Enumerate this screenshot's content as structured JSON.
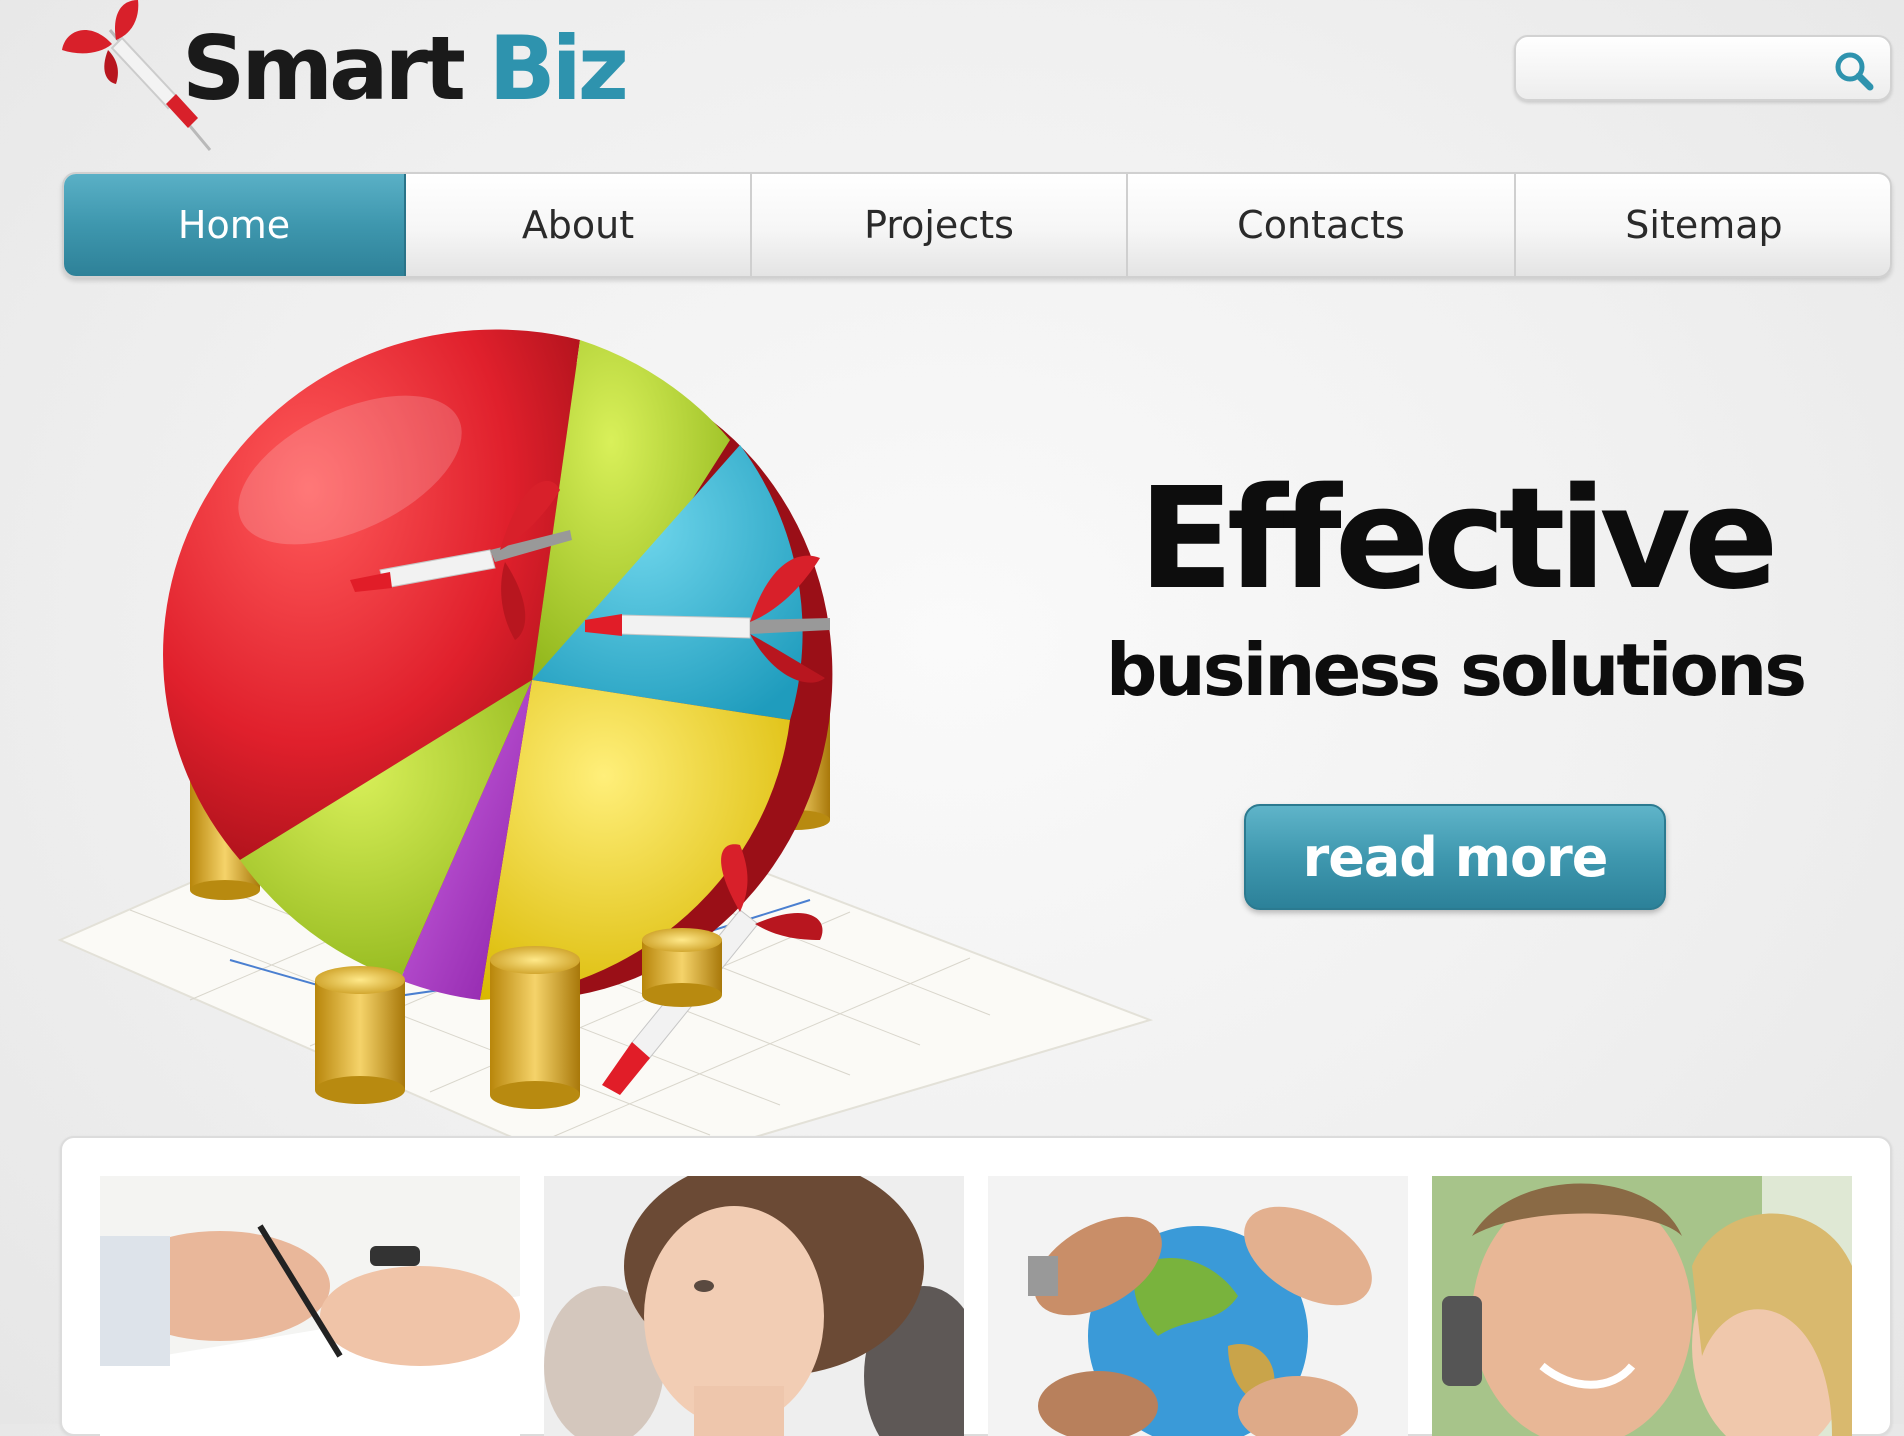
{
  "brand": {
    "name_part1": "Smart",
    "name_part2": "Biz",
    "accent_color": "#2e93ae",
    "logo_icon": "dart-icon"
  },
  "search": {
    "placeholder": "",
    "value": "",
    "icon": "search-icon"
  },
  "nav": {
    "items": [
      {
        "label": "Home",
        "active": true
      },
      {
        "label": "About",
        "active": false
      },
      {
        "label": "Projects",
        "active": false
      },
      {
        "label": "Contacts",
        "active": false
      },
      {
        "label": "Sitemap",
        "active": false
      }
    ]
  },
  "hero": {
    "title": "Effective",
    "subtitle": "business solutions",
    "cta_label": "read more",
    "image": "pie-chart-darts-coins-illustration"
  },
  "gallery": {
    "items": [
      {
        "image": "hands-signing-document-photo"
      },
      {
        "image": "woman-looking-up-photo"
      },
      {
        "image": "hands-holding-globe-photo"
      },
      {
        "image": "man-on-phone-with-woman-photo"
      }
    ]
  }
}
